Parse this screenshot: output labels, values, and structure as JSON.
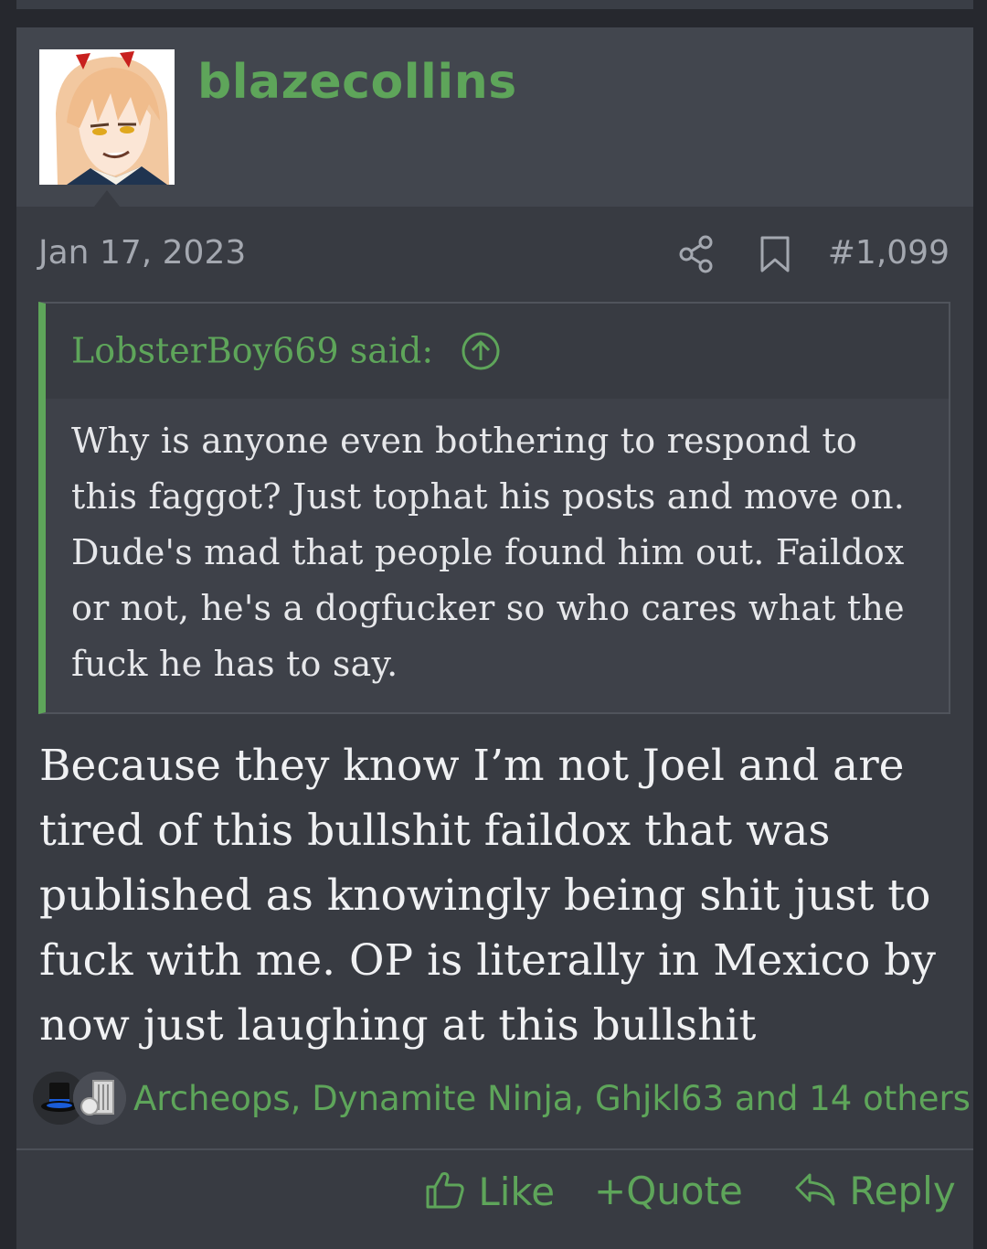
{
  "post": {
    "username": "blazecollins",
    "date": "Jan 17, 2023",
    "number": "#1,099",
    "quote": {
      "author_said": "LobsterBoy669 said:",
      "body": "Why is anyone even bothering to respond to this faggot? Just tophat his posts and move on. Dude's mad that people found him out. Faildox or not, he's a dogfucker so who cares what the fuck he has to say."
    },
    "message": "Because they know I’m not Joel and are tired of this bullshit faildox that was published as knowingly being shit just to fuck with me. OP is literally in Mexico by now just laughing at this bullshit",
    "reactions": {
      "icons": [
        "tophat-icon",
        "trash-icon"
      ],
      "text": "Archeops, Dynamite Ninja, Ghjkl63 and 14 others"
    },
    "actions": {
      "like": "Like",
      "quote": "+Quote",
      "reply": "Reply"
    }
  },
  "colors": {
    "accent": "#5ea55a",
    "background": "#383b42",
    "header": "#42464e",
    "text": "#f0f1f3",
    "muted": "#a4a8b0"
  }
}
